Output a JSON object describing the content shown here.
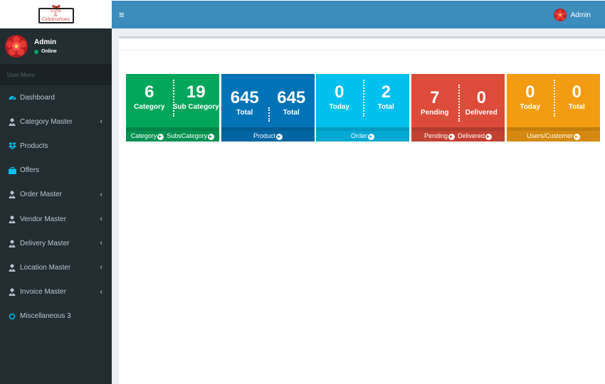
{
  "brand": {
    "logo_text_line1": "Gifts",
    "logo_text_line2": "&",
    "logo_text_line3": "Celebrations"
  },
  "user": {
    "name": "Admin",
    "status": "Online"
  },
  "sidebar": {
    "header": "User Menu",
    "items": [
      {
        "label": "Dashboard",
        "icon": "dashboard-icon",
        "has_children": false
      },
      {
        "label": "Category Master",
        "icon": "user-tie-icon",
        "has_children": true
      },
      {
        "label": "Products",
        "icon": "dropbox-icon",
        "has_children": false
      },
      {
        "label": "Offers",
        "icon": "briefcase-icon",
        "has_children": false
      },
      {
        "label": "Order Master",
        "icon": "user-tie-icon",
        "has_children": true
      },
      {
        "label": "Vendor Master",
        "icon": "user-tie-icon",
        "has_children": true
      },
      {
        "label": "Delivery Master",
        "icon": "user-tie-icon",
        "has_children": true
      },
      {
        "label": "Location Master",
        "icon": "user-tie-icon",
        "has_children": true
      },
      {
        "label": "Invoice Master",
        "icon": "user-tie-icon",
        "has_children": true
      },
      {
        "label": "Miscellaneous 3",
        "icon": "circle-icon",
        "has_children": false
      }
    ]
  },
  "header": {
    "menu_toggle": "≡",
    "user_label": "Admin"
  },
  "boxes": [
    {
      "color": "#00a65a",
      "left": {
        "value": "6",
        "label": "Category"
      },
      "right": {
        "value": "19",
        "label": "Sub Category"
      },
      "footer": [
        "Category",
        "SubsCategory"
      ]
    },
    {
      "color": "#0073b7",
      "left": {
        "value": "645",
        "label": "Total"
      },
      "right": {
        "value": "645",
        "label": "Total"
      },
      "footer": [
        "Product"
      ]
    },
    {
      "color": "#00c0ef",
      "left": {
        "value": "0",
        "label": "Today"
      },
      "right": {
        "value": "2",
        "label": "Total"
      },
      "footer": [
        "Order"
      ]
    },
    {
      "color": "#dd4b39",
      "left": {
        "value": "7",
        "label": "Pending"
      },
      "right": {
        "value": "0",
        "label": "Delivered"
      },
      "footer": [
        "Pending",
        "Delivered"
      ]
    },
    {
      "color": "#f39c12",
      "left": {
        "value": "0",
        "label": "Today"
      },
      "right": {
        "value": "0",
        "label": "Total"
      },
      "footer": [
        "Users/Customer"
      ]
    }
  ]
}
